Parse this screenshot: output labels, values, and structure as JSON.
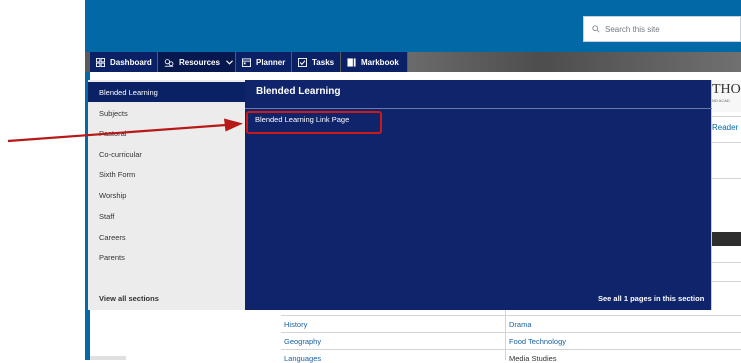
{
  "search": {
    "placeholder": "Search this site"
  },
  "nav": [
    {
      "label": "Dashboard",
      "icon": "dashboard-icon"
    },
    {
      "label": "Resources",
      "icon": "resources-icon",
      "active": true
    },
    {
      "label": "Planner",
      "icon": "planner-icon"
    },
    {
      "label": "Tasks",
      "icon": "tasks-icon"
    },
    {
      "label": "Markbook",
      "icon": "markbook-icon"
    }
  ],
  "background": {
    "logo_text": "THO",
    "logo_sub": "ND ACAD",
    "reader_link": "Reader",
    "table": {
      "rows": [
        [
          "History",
          "Drama"
        ],
        [
          "Geography",
          "Food Technology"
        ],
        [
          "Languages",
          "Media Studies"
        ]
      ]
    }
  },
  "dropdown": {
    "sections": [
      "Blended Learning",
      "Subjects",
      "Pastoral",
      "Co-curricular",
      "Sixth Form",
      "Worship",
      "Staff",
      "Careers",
      "Parents"
    ],
    "view_all": "View all sections",
    "panel": {
      "title": "Blended Learning",
      "link": "Blended Learning Link Page",
      "see_all": "See all 1 pages in this section"
    }
  },
  "colors": {
    "topbar": "#0369a6",
    "nav": "#0b2166",
    "panel": "#0f246b",
    "highlight": "#cc1a1a"
  }
}
